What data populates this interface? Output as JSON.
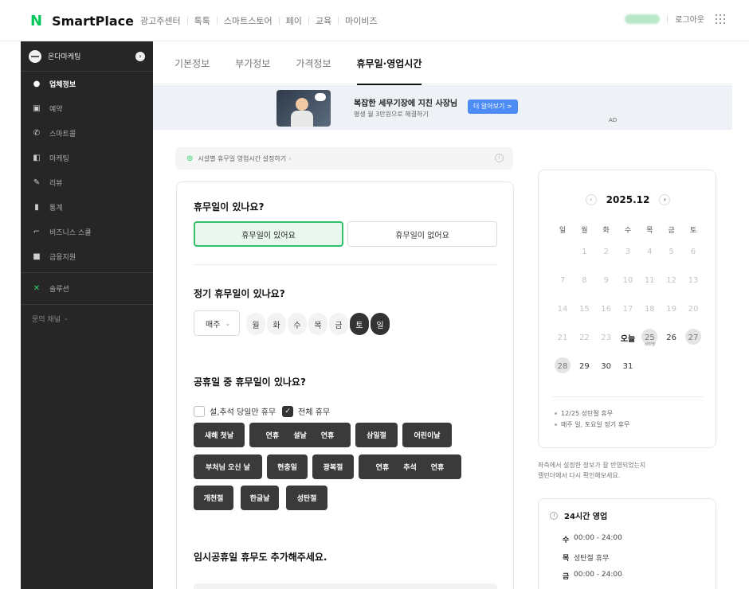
{
  "header": {
    "logo_mark": "N",
    "logo_text": "SmartPlace",
    "nav": [
      "광고주센터",
      "톡톡",
      "스마트스토어",
      "페이",
      "교육",
      "마이비즈"
    ],
    "logout": "로그아웃"
  },
  "sidebar": {
    "store_name": "온다마케팅",
    "items": [
      {
        "label": "업체정보",
        "icon": "info-icon",
        "active": true
      },
      {
        "label": "예약",
        "icon": "calendar-n-icon"
      },
      {
        "label": "스마트콜",
        "icon": "phone-icon"
      },
      {
        "label": "마케팅",
        "icon": "megaphone-icon"
      },
      {
        "label": "리뷰",
        "icon": "pen-icon"
      },
      {
        "label": "통계",
        "icon": "bar-chart-icon"
      },
      {
        "label": "비즈니스 스쿨",
        "icon": "school-icon"
      },
      {
        "label": "금융지원",
        "icon": "finance-icon"
      }
    ],
    "solution": "솔루션",
    "channel": "문의 채널"
  },
  "tabs": [
    "기본정보",
    "부가정보",
    "가격정보",
    "휴무일·영업시간"
  ],
  "ad": {
    "title": "복잡한 세무기장에 지친 사장님",
    "sub": "평생 월 3만원으로 해결하기",
    "button": "더 알아보기 >",
    "tag": "AD"
  },
  "notice": "시설별 휴무일 영업시간 설정하기",
  "holiday": {
    "question": "휴무일이 있나요?",
    "yes": "휴무일이 있어요",
    "no": "휴무일이 없어요"
  },
  "regular": {
    "question": "정기 휴무일이 있나요?",
    "frequency": "매주",
    "days": [
      {
        "label": "월",
        "on": false
      },
      {
        "label": "화",
        "on": false
      },
      {
        "label": "수",
        "on": false
      },
      {
        "label": "목",
        "on": false
      },
      {
        "label": "금",
        "on": false
      },
      {
        "label": "토",
        "on": true
      },
      {
        "label": "일",
        "on": true
      }
    ]
  },
  "public": {
    "question": "공휴일 중 휴무일이 있나요?",
    "option1": "설,추석 당일만 휴무",
    "option2": "전체 휴무",
    "option2_checked": true,
    "chips": [
      "새해 첫날",
      "연휴",
      "설날",
      "연휴",
      "삼일절",
      "어린이날",
      "부처님 오신 날",
      "현충일",
      "광복절",
      "연휴",
      "추석",
      "연휴",
      "개천절",
      "한글날",
      "성탄절"
    ]
  },
  "temporary": {
    "question": "임시공휴일 휴무도 추가해주세요."
  },
  "calendar": {
    "title": "2025.12",
    "weekdays": [
      "일",
      "월",
      "화",
      "수",
      "목",
      "금",
      "토"
    ],
    "today_label": "오늘",
    "holiday_sub": "성탄절",
    "notes": [
      "12/25 성탄절 휴무",
      "매주 일, 토요일 정기 휴무"
    ]
  },
  "side_text": [
    "좌측에서 설정한 정보가 잘 반영되었는지",
    "캘린더에서 다시 확인해보세요."
  ],
  "hours": {
    "title": "24시간 영업",
    "rows": [
      {
        "day": "수",
        "value": "00:00 - 24:00"
      },
      {
        "day": "목",
        "value": "성탄절 휴무"
      },
      {
        "day": "금",
        "value": "00:00 - 24:00"
      }
    ]
  },
  "colors": {
    "accent": "#03c75a",
    "sidebar": "#262626",
    "chip": "#3a3a3a",
    "ad_button": "#4d8cf5"
  }
}
